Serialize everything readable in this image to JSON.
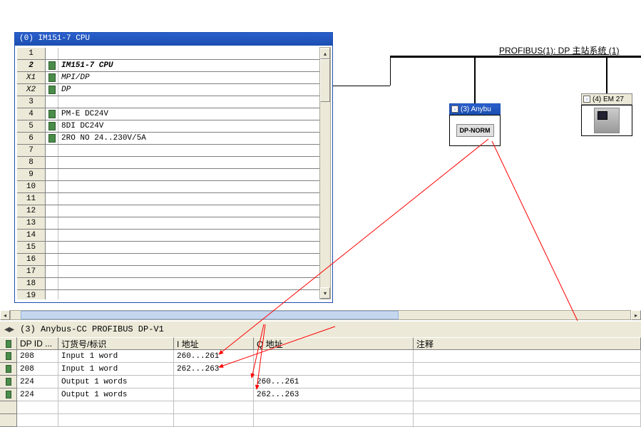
{
  "rack": {
    "title": "(0) IM151-7 CPU",
    "rows": [
      {
        "slot": "1",
        "label": "",
        "icon": false,
        "style": ""
      },
      {
        "slot": "2",
        "label": "IM151-7 CPU",
        "icon": true,
        "style": "bold"
      },
      {
        "slot": "X1",
        "label": "MPI/DP",
        "icon": true,
        "style": "italic"
      },
      {
        "slot": "X2",
        "label": "DP",
        "icon": true,
        "style": "italic"
      },
      {
        "slot": "3",
        "label": "",
        "icon": false,
        "style": ""
      },
      {
        "slot": "4",
        "label": "PM-E DC24V",
        "icon": true,
        "style": ""
      },
      {
        "slot": "5",
        "label": "8DI DC24V",
        "icon": true,
        "style": ""
      },
      {
        "slot": "6",
        "label": "2RO NO 24..230V/5A",
        "icon": true,
        "style": ""
      },
      {
        "slot": "7",
        "label": "",
        "icon": false,
        "style": ""
      },
      {
        "slot": "8",
        "label": "",
        "icon": false,
        "style": ""
      },
      {
        "slot": "9",
        "label": "",
        "icon": false,
        "style": ""
      },
      {
        "slot": "10",
        "label": "",
        "icon": false,
        "style": ""
      },
      {
        "slot": "11",
        "label": "",
        "icon": false,
        "style": ""
      },
      {
        "slot": "12",
        "label": "",
        "icon": false,
        "style": ""
      },
      {
        "slot": "13",
        "label": "",
        "icon": false,
        "style": ""
      },
      {
        "slot": "14",
        "label": "",
        "icon": false,
        "style": ""
      },
      {
        "slot": "15",
        "label": "",
        "icon": false,
        "style": ""
      },
      {
        "slot": "16",
        "label": "",
        "icon": false,
        "style": ""
      },
      {
        "slot": "17",
        "label": "",
        "icon": false,
        "style": ""
      },
      {
        "slot": "18",
        "label": "",
        "icon": false,
        "style": ""
      },
      {
        "slot": "19",
        "label": "",
        "icon": false,
        "style": ""
      }
    ]
  },
  "bus_label": "PROFIBUS(1): DP 主站系统 (1)",
  "node_anybus": {
    "title": "(3) Anybu",
    "body": "DP-NORM"
  },
  "node_em": {
    "title": "(4) EM 27"
  },
  "bottom": {
    "device_label": "(3)   Anybus-CC PROFIBUS DP-V1",
    "columns": [
      "DP ID ...",
      "订货号/标识",
      "I 地址",
      "Q 地址",
      "注释"
    ],
    "rows": [
      {
        "dpid": "208",
        "order": "Input 1 word",
        "iaddr": "260...261",
        "qaddr": "",
        "comment": ""
      },
      {
        "dpid": "208",
        "order": "Input 1 word",
        "iaddr": "262...263",
        "qaddr": "",
        "comment": ""
      },
      {
        "dpid": "224",
        "order": "Output 1 words",
        "iaddr": "",
        "qaddr": "260...261",
        "comment": ""
      },
      {
        "dpid": "224",
        "order": "Output 1 words",
        "iaddr": "",
        "qaddr": "262...263",
        "comment": ""
      },
      {
        "dpid": "",
        "order": "",
        "iaddr": "",
        "qaddr": "",
        "comment": ""
      },
      {
        "dpid": "",
        "order": "",
        "iaddr": "",
        "qaddr": "",
        "comment": ""
      }
    ]
  }
}
